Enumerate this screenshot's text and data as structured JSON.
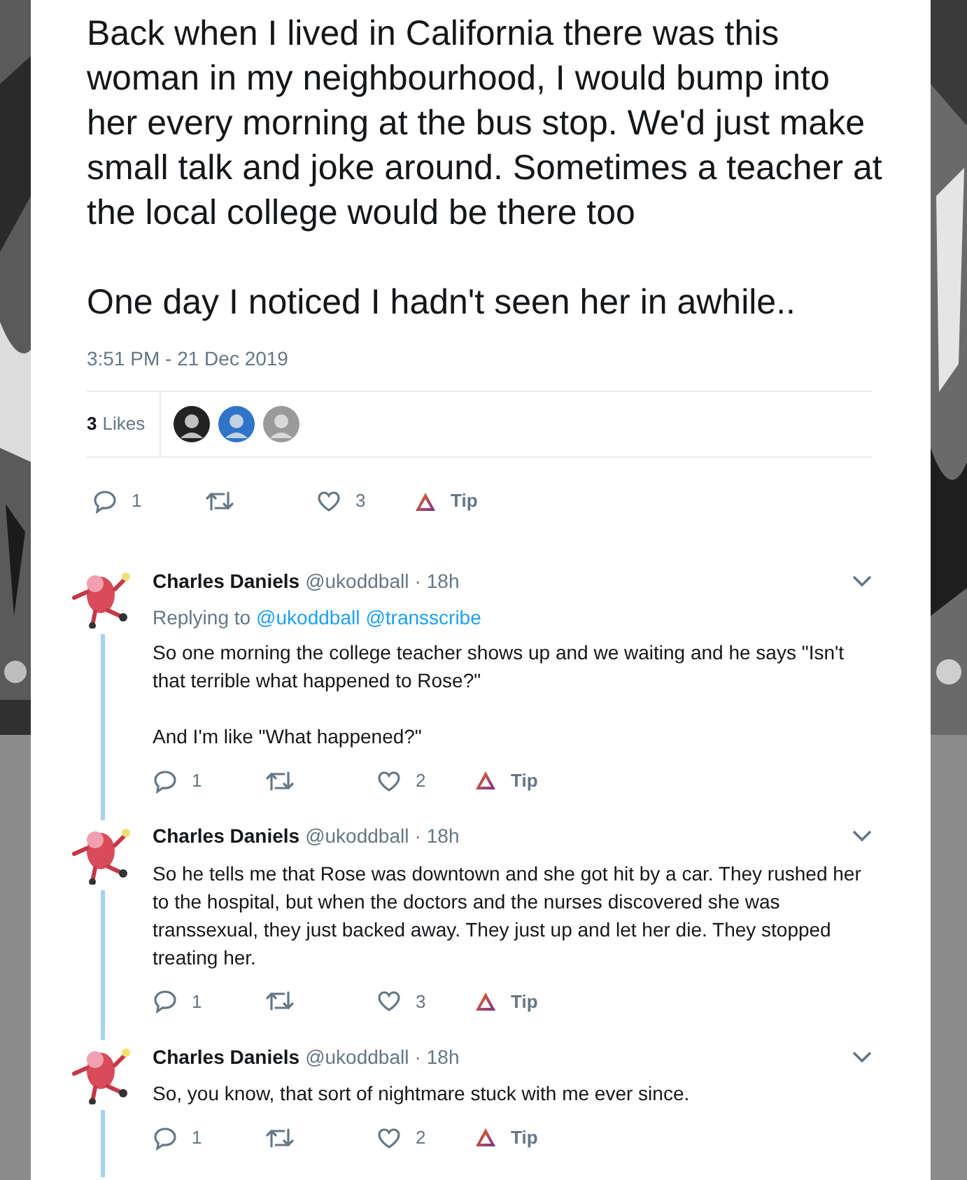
{
  "tweet": {
    "paragraphs": [
      "Back when I lived in California there was this woman in my neighbourhood, I would bump into her every morning at the bus stop. We'd just make small talk and joke around. Sometimes a teacher at the local college would be there too",
      "One day I noticed I hadn't seen her in awhile.."
    ],
    "timestamp": "3:51 PM - 21 Dec 2019",
    "likes_count": "3",
    "likes_label": "Likes",
    "likers": [
      {
        "color": "#222222"
      },
      {
        "color": "#2f74c9"
      },
      {
        "color": "#9a9a9a"
      }
    ],
    "actions": {
      "replies": "1",
      "likes": "3",
      "tip": "Tip"
    }
  },
  "replies": [
    {
      "author": "Charles Daniels",
      "handle": "@ukoddball",
      "separator": "·",
      "time": "18h",
      "replying_prefix": "Replying to",
      "mentions": [
        "@ukoddball",
        "@transscribe"
      ],
      "paragraphs": [
        "So one morning the college teacher shows up and we waiting and he says \"Isn't that terrible what happened to Rose?\"",
        "And I'm like \"What happened?\""
      ],
      "actions": {
        "replies": "1",
        "likes": "2",
        "tip": "Tip"
      }
    },
    {
      "author": "Charles Daniels",
      "handle": "@ukoddball",
      "separator": "·",
      "time": "18h",
      "paragraphs": [
        "So he tells me that Rose was downtown and she got hit by a car. They rushed her to the hospital, but when the doctors and the nurses discovered she was transsexual, they just backed away. They just up and let her die. They stopped treating her."
      ],
      "actions": {
        "replies": "1",
        "likes": "3",
        "tip": "Tip"
      }
    },
    {
      "author": "Charles Daniels",
      "handle": "@ukoddball",
      "separator": "·",
      "time": "18h",
      "paragraphs": [
        "So, you know, that sort of nightmare stuck with me ever since."
      ],
      "actions": {
        "replies": "1",
        "likes": "2",
        "tip": "Tip"
      }
    }
  ]
}
